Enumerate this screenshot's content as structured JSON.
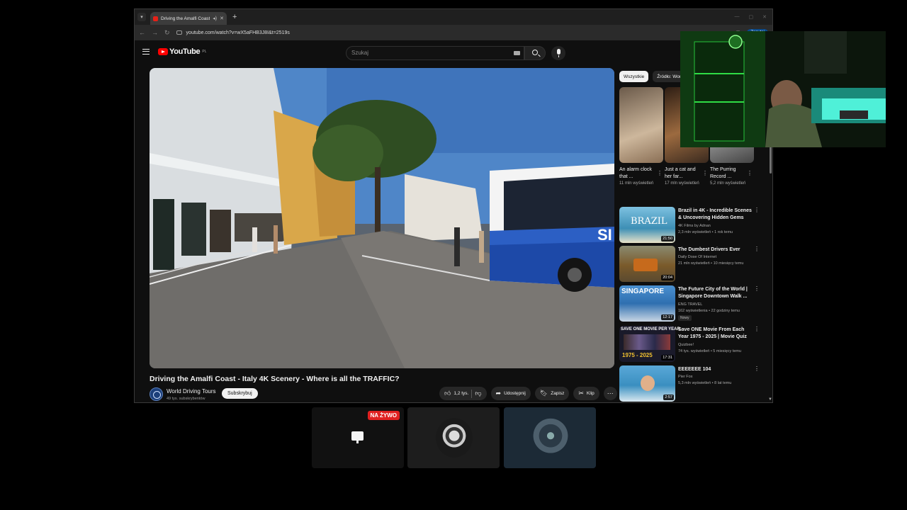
{
  "browser": {
    "tab_title": "Driving the Amalfi Coast - I",
    "tab_audio_icon": "speaker-icon",
    "url": "youtube.com/watch?v=wX5aFHB3J8I&t=2519s",
    "ask_button": "Zapytaj"
  },
  "youtube": {
    "logo_text": "YouTube",
    "region": "PL",
    "search_placeholder": "Szukaj",
    "video": {
      "title": "Driving the Amalfi Coast - Italy 4K Scenery - Where is all the TRAFFIC?",
      "channel": "World Driving Tours",
      "subscribers": "49 tys. subskrybentów",
      "subscribe_label": "Subskrybuj",
      "likes": "1,2 tys.",
      "share_label": "Udostępnij",
      "save_label": "Zapisz",
      "clip_label": "Klip"
    },
    "chips": [
      {
        "label": "Wszystkie",
        "active": true
      },
      {
        "label": "Źródło: World",
        "active": false
      }
    ],
    "shorts": [
      {
        "title": "An alarm clock that ...",
        "views": "11 mln wyświetleń"
      },
      {
        "title": "Just a cat and her far...",
        "views": "17 mln wyświetleń"
      },
      {
        "title": "The Purring Record ...",
        "views": "5,2 mln wyświetleń"
      }
    ],
    "recommendations": [
      {
        "title": "Brazil in 4K - Incredible Scenes & Uncovering Hidden Gems",
        "channel": "4K Films by Adnan",
        "meta": "2,3 mln wyświetleń • 1 rok temu",
        "duration": "21:50",
        "thumb_text": "BRAZIL",
        "thumb_color": "#3d8fb5"
      },
      {
        "title": "The Dumbest Drivers Ever",
        "channel": "Daily Dose Of Internet",
        "meta": "21 mln wyświetleń • 10 miesięcy temu",
        "duration": "20:04",
        "thumb_text": "",
        "thumb_color": "#7a5a2a"
      },
      {
        "title": "The Future City of the World | Singapore Downtown Walk ...",
        "channel": "ENG TRAVEL",
        "meta": "162 wyświetlenia • 22 godziny temu",
        "duration": "12:17",
        "thumb_text": "SINGAPORE",
        "thumb_color": "#2f6fb0",
        "badge": "Nowy"
      },
      {
        "title": "Save ONE Movie From Each Year 1975 - 2025 | Movie Quiz",
        "channel": "Quizbee!",
        "meta": "74 tys. wyświetleń • 5 miesięcy temu",
        "duration": "17:31",
        "thumb_text": "SAVE ONE MOVIE PER YEAR",
        "thumb_color": "#1a1a2a",
        "thumb_sub": "1975 - 2025"
      },
      {
        "title": "EEEEEEE 104",
        "channel": "Pier Fox",
        "meta": "5,3 mln wyświetleń • 8 lat temu",
        "duration": "2:57",
        "thumb_text": "",
        "thumb_color": "#3a8fc0"
      }
    ]
  },
  "stream": {
    "live_badge": "NA ŻYWO"
  }
}
